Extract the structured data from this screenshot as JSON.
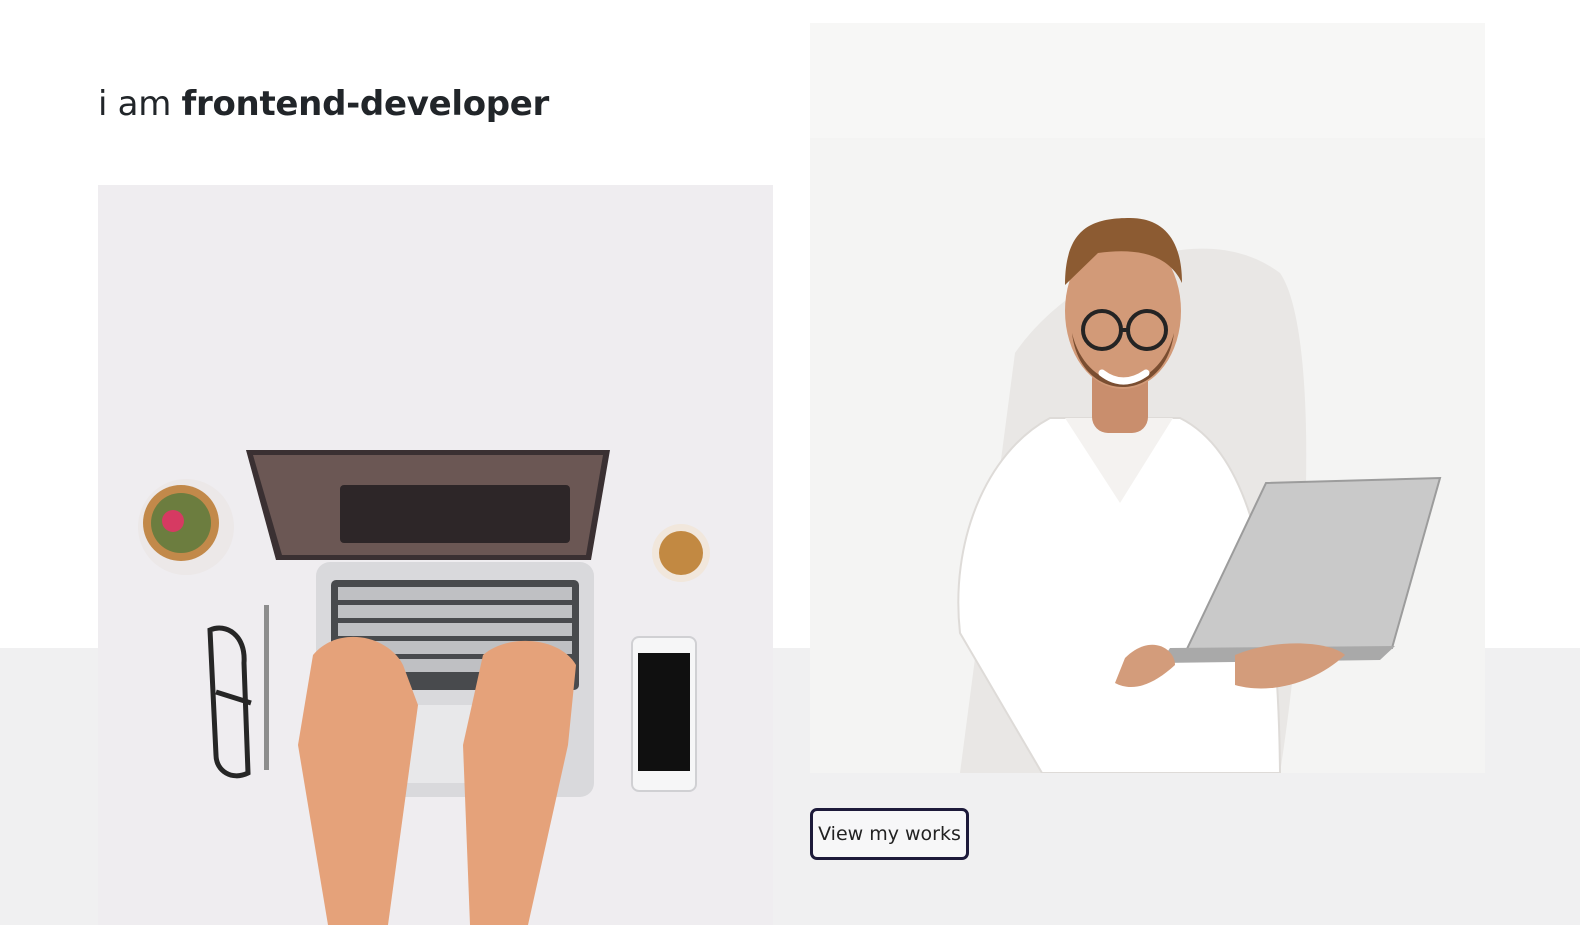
{
  "hero": {
    "headline_prefix": "i am",
    "headline_strong": "frontend-developer",
    "cta_label": "View my works"
  },
  "images": {
    "desk_photo": "laptop-desk-photo",
    "developer_photo": "developer-holding-laptop-photo"
  },
  "colors": {
    "text": "#212529",
    "band": "#f0f0f1",
    "button_border": "#1d1a3a"
  }
}
